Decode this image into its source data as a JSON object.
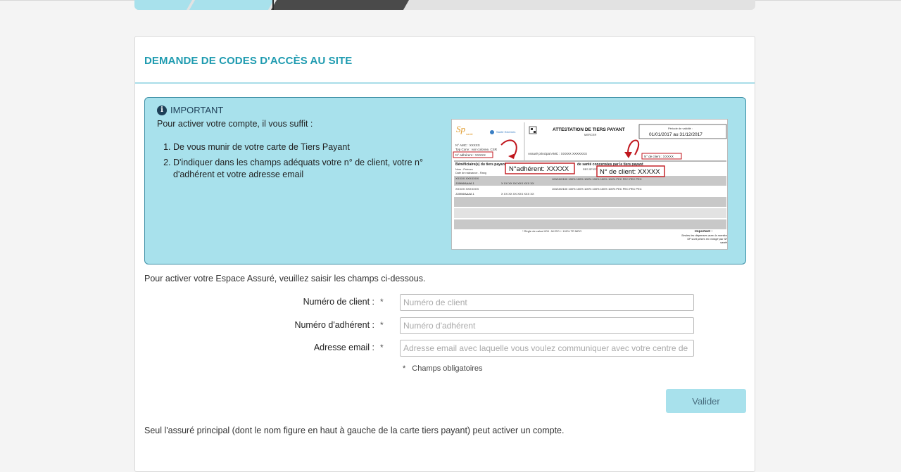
{
  "page": {
    "title": "DEMANDE DE CODES D'ACCÈS AU SITE"
  },
  "info": {
    "heading": "IMPORTANT",
    "intro": "Pour activer votre compte, il vous suffit :",
    "steps": [
      "De vous munir de votre carte de Tiers Payant",
      "D'indiquer dans les champs adéquats votre n° de client, votre n° d'adhérent et votre adresse email"
    ],
    "card_image": {
      "header_title": "ATTESTATION DE TIERS PAYANT",
      "header_sub": "MERCER",
      "validity_label": "Période de validité :",
      "validity_dates": "01/01/2017  au  31/12/2017",
      "brand": "SP santé",
      "brand_partner": "Santé Externes",
      "amc": "N° AMC : XXXXX",
      "typ_conv": "Typ Conv : voir colonne, CSR",
      "adherent_small": "N° adhérent : XXXXX",
      "assure": "Assuré principal AMC : XXXXX XXXXXXX",
      "client_small": "N° de client : XXXXX",
      "beneficiaires": "Bénéficiaire(s) du tiers payant",
      "concerned": "de santé concernées par le tiers payant",
      "callout_adherent": "N°adhérent: XXXXX",
      "callout_client": "N° de client: XXXXX",
      "col_name": "Nom - Prénom",
      "col_date": "Date de naissance - Rang",
      "row1_name": "XXXXX XXXXXXX",
      "row1_date": "JJ/MM/AAAA     1",
      "row1_ids": "X  XX  XX  XX  XXX  XXX  XX",
      "row2_name": "XXXXX XXXXXXX",
      "row2_date": "JJ/MM/AAAA     1",
      "row2_ids": "X  XX  XX  XX  XXX  XXX  XX",
      "rates": "100/100/100   100%   100%   100%   100%   100%   100%   PEC   PEC   PEC   PEC",
      "headers_right": "RES  SP   EFR   HOSP  OPTI  AMB",
      "footer_rule": "*  Règle de calcul 009 : MI RO + 100% TR MRO",
      "footer_important": "Important :",
      "footer_note": "Seules les dépenses avec la mention SP sont prises en charge par SP santé."
    }
  },
  "form": {
    "lead": "Pour activer votre Espace Assuré, veuillez saisir les champs ci-dessous.",
    "required_mark": "*",
    "fields": [
      {
        "label": "Numéro de client :",
        "placeholder": "Numéro de client",
        "value": ""
      },
      {
        "label": "Numéro d'adhérent :",
        "placeholder": "Numéro d'adhérent",
        "value": ""
      },
      {
        "label": "Adresse email :",
        "placeholder": "Adresse email avec laquelle vous voulez communiquer avec votre centre de gestion",
        "value": ""
      }
    ],
    "mandatory_note": "Champs obligatoires",
    "submit_label": "Valider"
  },
  "footnote": "Seul l'assuré principal (dont le nom figure en haut à gauche de la carte tiers payant) peut activer un compte.",
  "colors": {
    "accent": "#1f9bb0",
    "info_bg": "#a8e1ec",
    "info_border": "#3c8fa6",
    "stepper_active": "#4a4a4a",
    "stepper_done": "#a8e1ec",
    "callout_red": "#c0161d"
  }
}
